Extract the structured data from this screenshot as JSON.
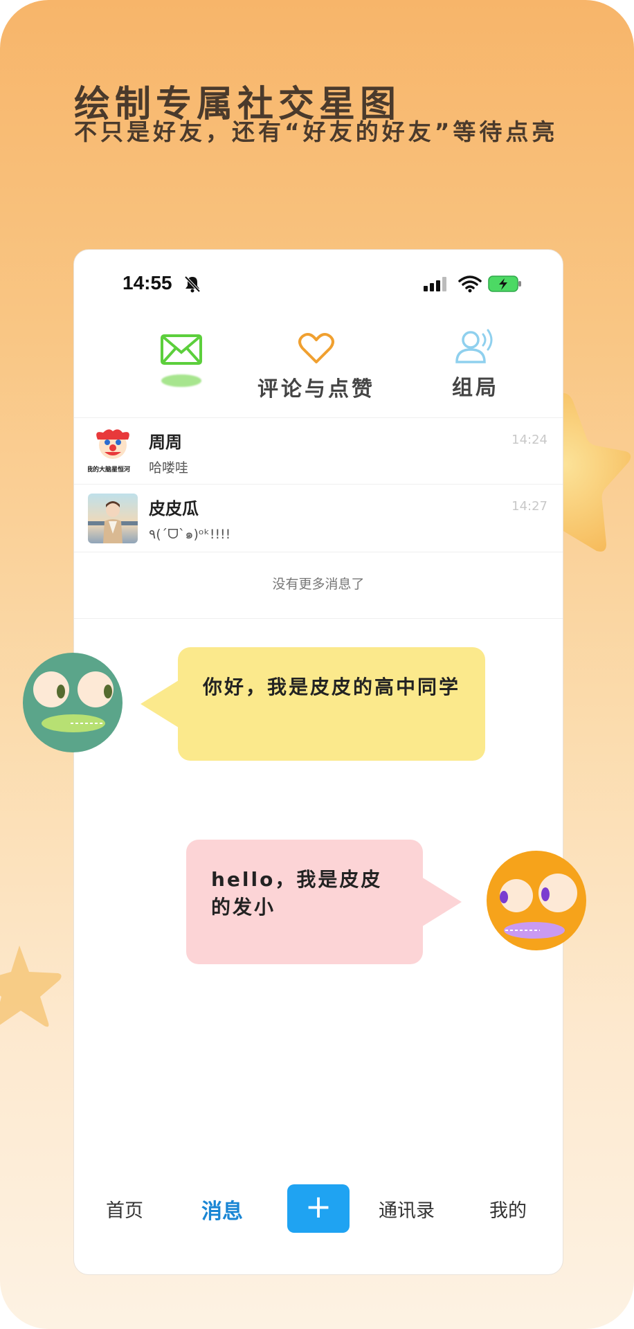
{
  "hero": {
    "title": "绘制专属社交星图",
    "subtitle": "不只是好友，还有“好友的好友”等待点亮"
  },
  "status_bar": {
    "time": "14:55"
  },
  "top_tabs": [
    {
      "label": "",
      "icon": "envelope-icon"
    },
    {
      "label": "评论与点赞",
      "icon": "heart-icon"
    },
    {
      "label": "组局",
      "icon": "person-broadcast-icon"
    }
  ],
  "conversations": [
    {
      "name": "周周",
      "preview": "哈喽哇",
      "time": "14:24",
      "avatar_caption": "我的大脑星恒河"
    },
    {
      "name": "皮皮瓜",
      "preview": "٩(ˊᗜˋ๑)ᵒᵏ!!!!",
      "time": "14:27"
    }
  ],
  "list_footer": "没有更多消息了",
  "bubbles": {
    "left": "你好，我是皮皮的高中同学",
    "right": "hello，我是皮皮的发小"
  },
  "bottom_nav": {
    "home": "首页",
    "messages": "消息",
    "add": "+",
    "contacts": "通讯录",
    "me": "我的"
  },
  "colors": {
    "accent": "#1a86d4",
    "add_button": "#1fa3f2",
    "bubble_yellow": "#fbe98c",
    "bubble_pink": "#fcd4d6",
    "envelope_green": "#5ccf3c",
    "heart_orange": "#f0a030",
    "group_blue": "#8fd0ee"
  }
}
